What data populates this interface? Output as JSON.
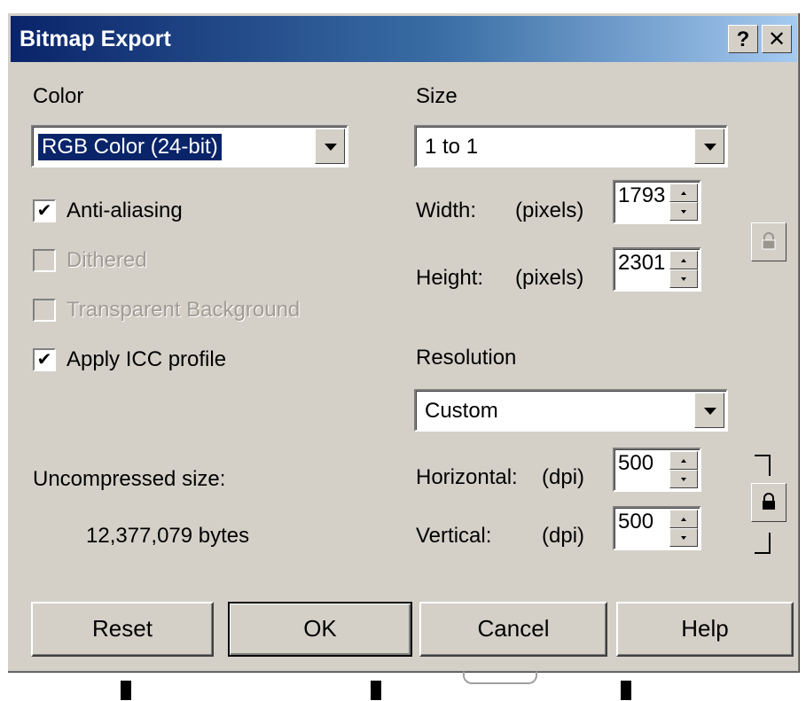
{
  "window": {
    "title": "Bitmap Export",
    "help_button": "?",
    "close_button": "✕"
  },
  "color": {
    "label": "Color",
    "mode_value": "RGB Color (24-bit)",
    "anti_aliasing": {
      "label": "Anti-aliasing",
      "checked": true
    },
    "dithered": {
      "label": "Dithered",
      "checked": false,
      "enabled": false
    },
    "transparent_bg": {
      "label": "Transparent Background",
      "checked": false,
      "enabled": false
    },
    "apply_icc": {
      "label": "Apply ICC profile",
      "checked": true
    },
    "uncompressed_label": "Uncompressed size:",
    "uncompressed_value": "12,377,079 bytes"
  },
  "size": {
    "label": "Size",
    "preset_value": "1 to 1",
    "width_label": "Width:",
    "width_unit": "(pixels)",
    "width_value": "1793",
    "height_label": "Height:",
    "height_unit": "(pixels)",
    "height_value": "2301"
  },
  "resolution": {
    "label": "Resolution",
    "preset_value": "Custom",
    "horizontal_label": "Horizontal:",
    "horizontal_unit": "(dpi)",
    "horizontal_value": "500",
    "vertical_label": "Vertical:",
    "vertical_unit": "(dpi)",
    "vertical_value": "500"
  },
  "buttons": {
    "reset": "Reset",
    "ok": "OK",
    "cancel": "Cancel",
    "help": "Help"
  },
  "icons": {
    "size_lock": "lock-icon-disabled",
    "resolution_lock": "lock-icon"
  },
  "colors": {
    "titlebar_start": "#0a246a",
    "titlebar_end": "#a6caf0",
    "face": "#d4d0c8",
    "selection": "#0a246a"
  }
}
